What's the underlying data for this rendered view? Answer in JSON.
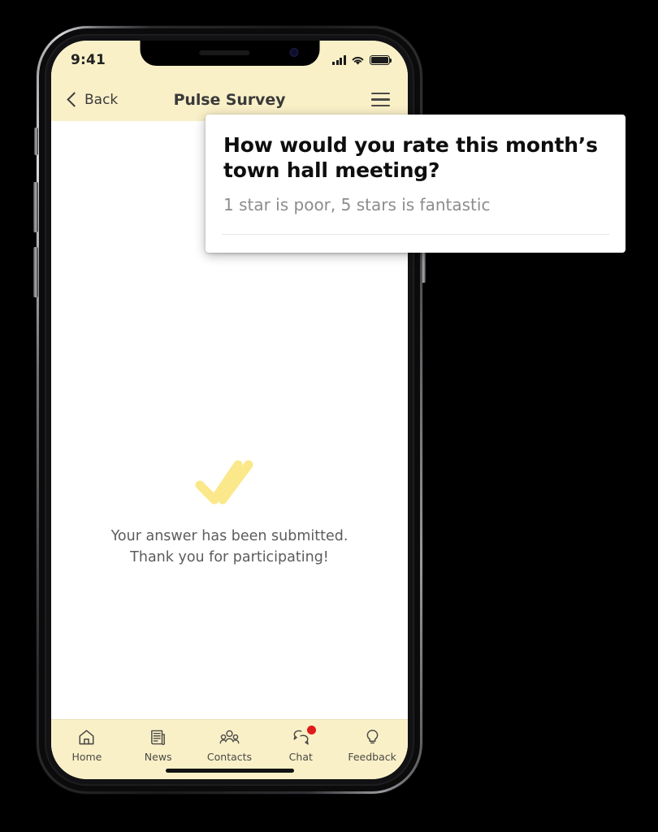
{
  "device": {
    "status_bar": {
      "time": "9:41",
      "icons": [
        "signal-bars-icon",
        "wifi-icon",
        "battery-icon"
      ]
    },
    "home_indicator": "home-indicator"
  },
  "nav_header": {
    "back_label": "Back",
    "back_icon": "chevron-left-icon",
    "title": "Pulse Survey",
    "menu_icon": "hamburger-menu-icon"
  },
  "popup": {
    "question": "How would you rate this month’s town hall meeting?",
    "subtitle": "1 star is poor, 5 stars is fantastic"
  },
  "content": {
    "icon": "double-check-icon",
    "confirmation_line_1": "Your answer has been submitted.",
    "confirmation_line_2": "Thank you for participating!"
  },
  "tab_bar": {
    "items": [
      {
        "label": "Home",
        "icon": "home-icon",
        "badge": false
      },
      {
        "label": "News",
        "icon": "newspaper-icon",
        "badge": false
      },
      {
        "label": "Contacts",
        "icon": "people-group-icon",
        "badge": false
      },
      {
        "label": "Chat",
        "icon": "chat-bubbles-icon",
        "badge": true
      },
      {
        "label": "Feedback",
        "icon": "lightbulb-icon",
        "badge": false
      }
    ]
  },
  "colors": {
    "header_cream": "#faf0c8",
    "accent_yellow": "#fae88a",
    "badge_red": "#e01b1b",
    "text_dark": "#3a3a3a",
    "text_muted": "#8c8c8c",
    "screen_white": "#ffffff"
  }
}
